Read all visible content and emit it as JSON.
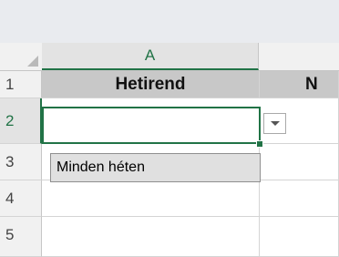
{
  "sheet": {
    "column_headers": [
      "A"
    ],
    "row_numbers": [
      "1",
      "2",
      "3",
      "4",
      "5"
    ],
    "cells": {
      "a1": "Hetirend",
      "b1": "N",
      "a2": ""
    },
    "dropdown_options": [
      "Minden héten"
    ]
  },
  "icons": {
    "corner": "select-all-triangle-icon",
    "dropdown": "dropdown-arrow-icon"
  },
  "colors": {
    "accent": "#217346",
    "header_fill": "#c8c8c8",
    "list_fill": "#e0e0e0"
  }
}
